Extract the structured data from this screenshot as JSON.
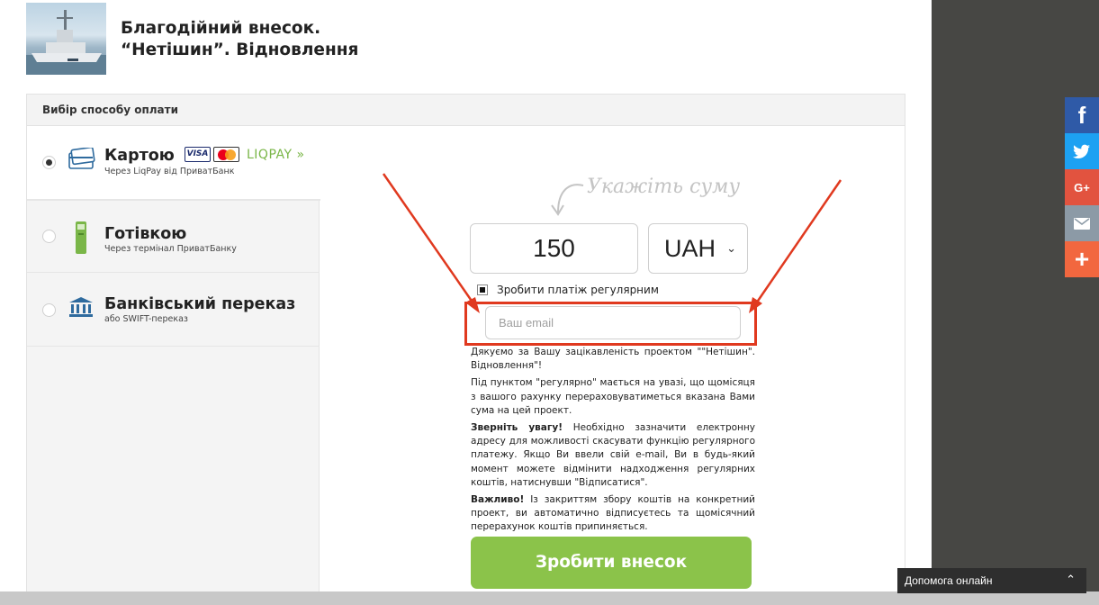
{
  "header": {
    "title_line1": "Благодійний внесок.",
    "title_line2": "“Нетішин”. Відновлення"
  },
  "payment": {
    "section_title": "Вибір способу оплати",
    "methods": [
      {
        "label": "Картою",
        "sub": "Через LiqPay від ПриватБанк",
        "selected": true
      },
      {
        "label": "Готівкою",
        "sub": "Через термінал ПриватБанку",
        "selected": false
      },
      {
        "label": "Банківський переказ",
        "sub": "або SWIFT-переказ",
        "selected": false
      }
    ],
    "logos": {
      "visa": "VISA",
      "mastercard": "MasterCard",
      "liqpay": "LIQPAY"
    }
  },
  "form": {
    "hint": "Укажіть суму",
    "amount": "150",
    "currency": "UAH",
    "regular_label": "Зробити платіж регулярним",
    "email_placeholder": "Ваш email",
    "submit_label": "Зробити внесок"
  },
  "info": {
    "p1": "Дякуємо за Вашу зацікавленість проектом \"\"Нетішин\". Відновлення\"!",
    "p2": "Під пунктом \"регулярно\" мається на увазі, що щомісяця з вашого рахунку перераховуватиметься вказана Вами сума на цей проект.",
    "p3_bold": "Зверніть увагу!",
    "p3": " Необхідно зазначити електронну адресу для можливості скасувати функцію регулярного платежу. Якщо Ви ввели свій e-mail, Ви в будь-який момент можете відмінити надходження регулярних коштів, натиснувши \"Відписатися\".",
    "p4_bold": "Важливо!",
    "p4": " Із закриттям збору коштів на конкретний проект, ви автоматично відписуєтесь та щомісячний перерахунок коштів припиняється."
  },
  "social": {
    "facebook": "f",
    "googleplus": "G+",
    "plus": "+"
  },
  "help": {
    "label": "Допомога онлайн"
  },
  "colors": {
    "submit": "#8bc34a",
    "highlight": "#e0391f",
    "facebook": "#2f5aa7",
    "twitter": "#1da1f2",
    "googleplus": "#e2533f",
    "email": "#8c9aa6",
    "share": "#f2673f",
    "liqpay": "#7ab648"
  }
}
